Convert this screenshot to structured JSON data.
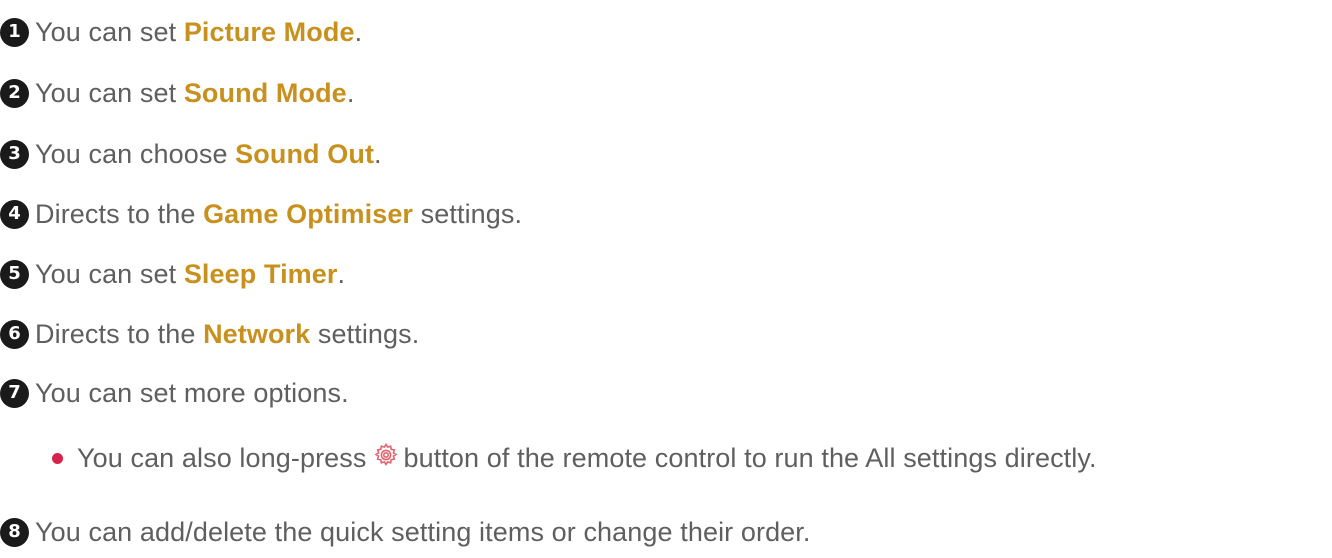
{
  "items": [
    {
      "num": "1",
      "pre": "You can set ",
      "hl": "Picture Mode",
      "post": "."
    },
    {
      "num": "2",
      "pre": "You can set ",
      "hl": "Sound Mode",
      "post": "."
    },
    {
      "num": "3",
      "pre": "You can choose ",
      "hl": "Sound Out",
      "post": "."
    },
    {
      "num": "4",
      "pre": "Directs to the ",
      "hl": "Game Optimiser",
      "post": " settings."
    },
    {
      "num": "5",
      "pre": "You can set ",
      "hl": "Sleep Timer",
      "post": "."
    },
    {
      "num": "6",
      "pre": "Directs to the ",
      "hl": "Network",
      "post": " settings."
    },
    {
      "num": "7",
      "pre": "You can set more options.",
      "hl": "",
      "post": ""
    },
    {
      "num": "8",
      "pre": "You can add/delete the quick setting items or change their order.",
      "hl": "",
      "post": ""
    }
  ],
  "note": {
    "pre": "You can also long-press",
    "icon": "settings-gear-icon",
    "post": "button of the remote control to run the All settings directly."
  },
  "colors": {
    "highlight": "#c8911e",
    "text": "#5f5f5f",
    "badge": "#1a1a1a",
    "bullet": "#d7224a",
    "gear_icon": "#e0646e"
  }
}
